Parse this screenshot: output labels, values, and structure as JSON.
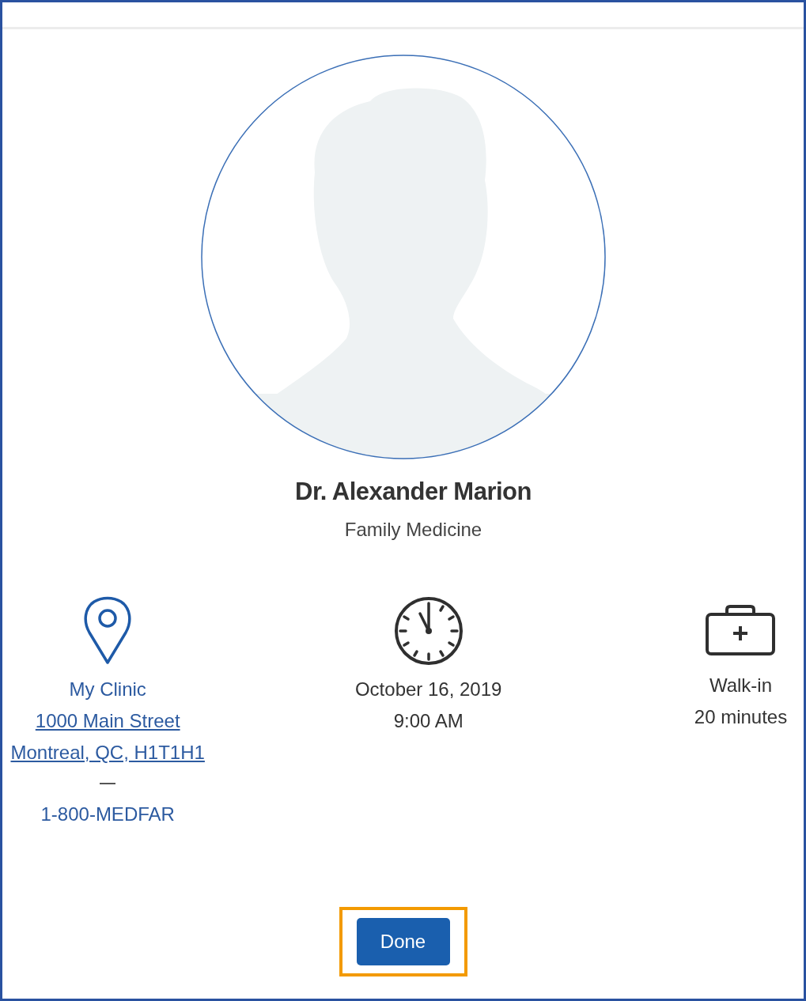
{
  "doctor": {
    "name": "Dr. Alexander Marion",
    "specialty": "Family Medicine"
  },
  "details": [
    {
      "kind": "location",
      "lines": [
        {
          "text": "My Clinic",
          "link": false
        },
        {
          "text": "1000 Main Street",
          "link": true
        },
        {
          "text": "Montreal, QC, H1T1H1",
          "link": true
        }
      ],
      "phone": "1-800-MEDFAR"
    },
    {
      "kind": "time",
      "lines": [
        {
          "text": "October 16, 2019",
          "link": false
        },
        {
          "text": "9:00 AM",
          "link": false
        }
      ]
    },
    {
      "kind": "visit",
      "lines": [
        {
          "text": "Walk-in",
          "link": false
        },
        {
          "text": "20 minutes",
          "link": false
        }
      ]
    }
  ],
  "button": {
    "label": "Done",
    "highlighted": true
  }
}
